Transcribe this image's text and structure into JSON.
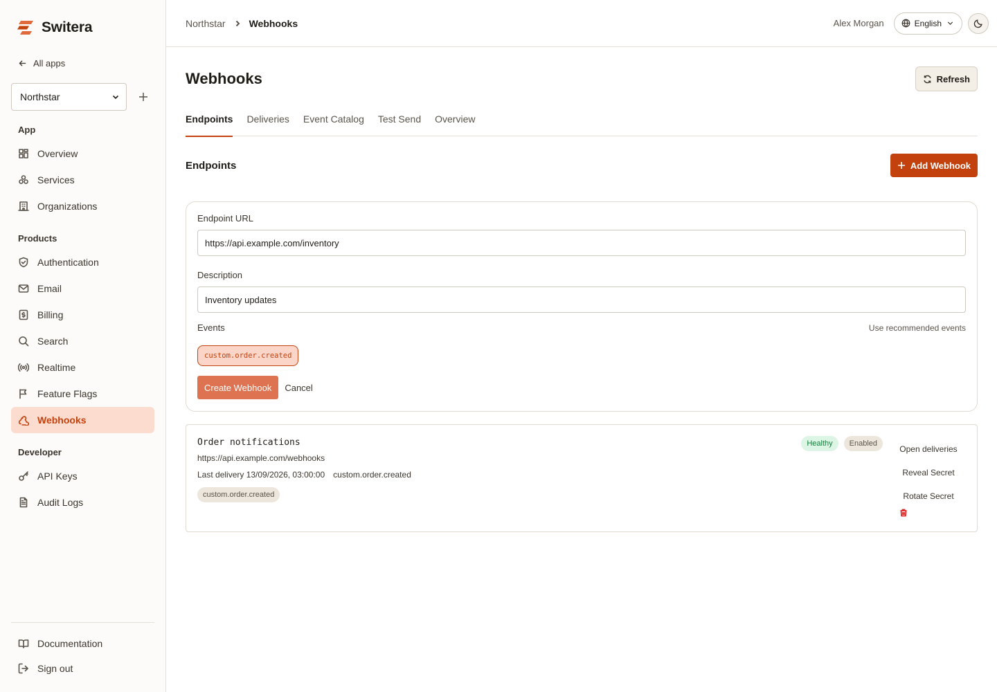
{
  "brand": {
    "name": "Switera"
  },
  "sidebar": {
    "back_label": "All apps",
    "app_select": {
      "value": "Northstar"
    },
    "sections": {
      "app": "App",
      "products": "Products",
      "developer": "Developer"
    },
    "app_items": [
      "Overview",
      "Services",
      "Organizations"
    ],
    "product_items": [
      "Authentication",
      "Email",
      "Billing",
      "Search",
      "Realtime",
      "Feature Flags",
      "Webhooks"
    ],
    "developer_items": [
      "API Keys",
      "Audit Logs"
    ],
    "bottom_items": [
      "Documentation",
      "Sign out"
    ],
    "active_item": "Webhooks"
  },
  "topbar": {
    "breadcrumb": [
      "Northstar",
      "Webhooks"
    ],
    "user_name": "Alex Morgan",
    "language": "English"
  },
  "page": {
    "title": "Webhooks",
    "refresh_label": "Refresh",
    "tabs": [
      "Endpoints",
      "Deliveries",
      "Event Catalog",
      "Test Send",
      "Overview"
    ],
    "active_tab": "Endpoints"
  },
  "endpoints": {
    "title": "Endpoints",
    "add_label": "Add Webhook"
  },
  "form": {
    "url_label": "Endpoint URL",
    "url_value": "https://api.example.com/inventory",
    "description_label": "Description",
    "description_value": "Inventory updates",
    "events_label": "Events",
    "recommended_label": "Use recommended events",
    "selected_event": "custom.order.created",
    "create_label": "Create Webhook",
    "cancel_label": "Cancel"
  },
  "webhook": {
    "name": "Order notifications",
    "url": "https://api.example.com/webhooks",
    "last_delivery": "Last delivery 13/09/2026, 03:00:00",
    "last_event": "custom.order.created",
    "event_chip": "custom.order.created",
    "status_badge": "Healthy",
    "enabled_badge": "Enabled",
    "actions": [
      "Open deliveries",
      "Reveal Secret",
      "Rotate Secret"
    ]
  },
  "colors": {
    "accent": "#c2410c",
    "accent_soft": "#fddcd0",
    "healthy": "#15803d",
    "danger": "#dc2626"
  },
  "icons": {
    "back": "arrow-left-icon",
    "overview": "grid-icon",
    "services": "boxes-icon",
    "organizations": "building-icon",
    "authentication": "shield-check-icon",
    "email": "mail-icon",
    "billing": "receipt-icon",
    "search": "search-icon",
    "realtime": "broadcast-icon",
    "feature_flags": "flag-icon",
    "webhooks": "webhook-icon",
    "api_keys": "key-icon",
    "audit_logs": "file-text-icon",
    "documentation": "book-icon",
    "sign_out": "log-out-icon"
  }
}
